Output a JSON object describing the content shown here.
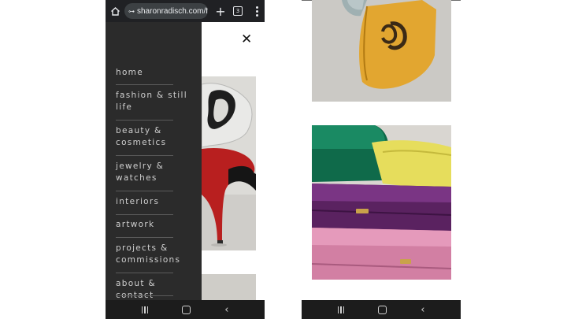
{
  "left_phone": {
    "browser": {
      "url": "sharonradisch.com/fa",
      "tab_count": "3",
      "icons": {
        "home": "home-icon",
        "site_info": "tune-icon",
        "new_tab": "plus-icon",
        "tabs": "tabs-icon",
        "menu": "kebab-menu-icon"
      }
    },
    "close_icon": "close-icon",
    "menu": {
      "items": [
        {
          "label": "home"
        },
        {
          "label": "fashion & still life"
        },
        {
          "label": "beauty & cosmetics"
        },
        {
          "label": "jewelry & watches"
        },
        {
          "label": "interiors"
        },
        {
          "label": "artwork"
        },
        {
          "label": "projects & commissions"
        },
        {
          "label": "about & contact"
        }
      ]
    },
    "images": [
      {
        "name": "red-stiletto-shoe-photo"
      },
      {
        "name": "partial-photo"
      }
    ],
    "navbar": {
      "icons": [
        "recents-icon",
        "home-icon",
        "back-icon"
      ]
    }
  },
  "right_phone": {
    "images": [
      {
        "name": "yellow-handbag-photo"
      },
      {
        "name": "stacked-clutch-bags-photo"
      }
    ],
    "navbar": {
      "icons": [
        "recents-icon",
        "home-icon",
        "back-icon"
      ]
    }
  },
  "colors": {
    "drawer_bg": "#2b2b2b",
    "menu_text": "#cfcfcf",
    "chrome_bar": "#202124",
    "navbar": "#1c1c1c"
  }
}
